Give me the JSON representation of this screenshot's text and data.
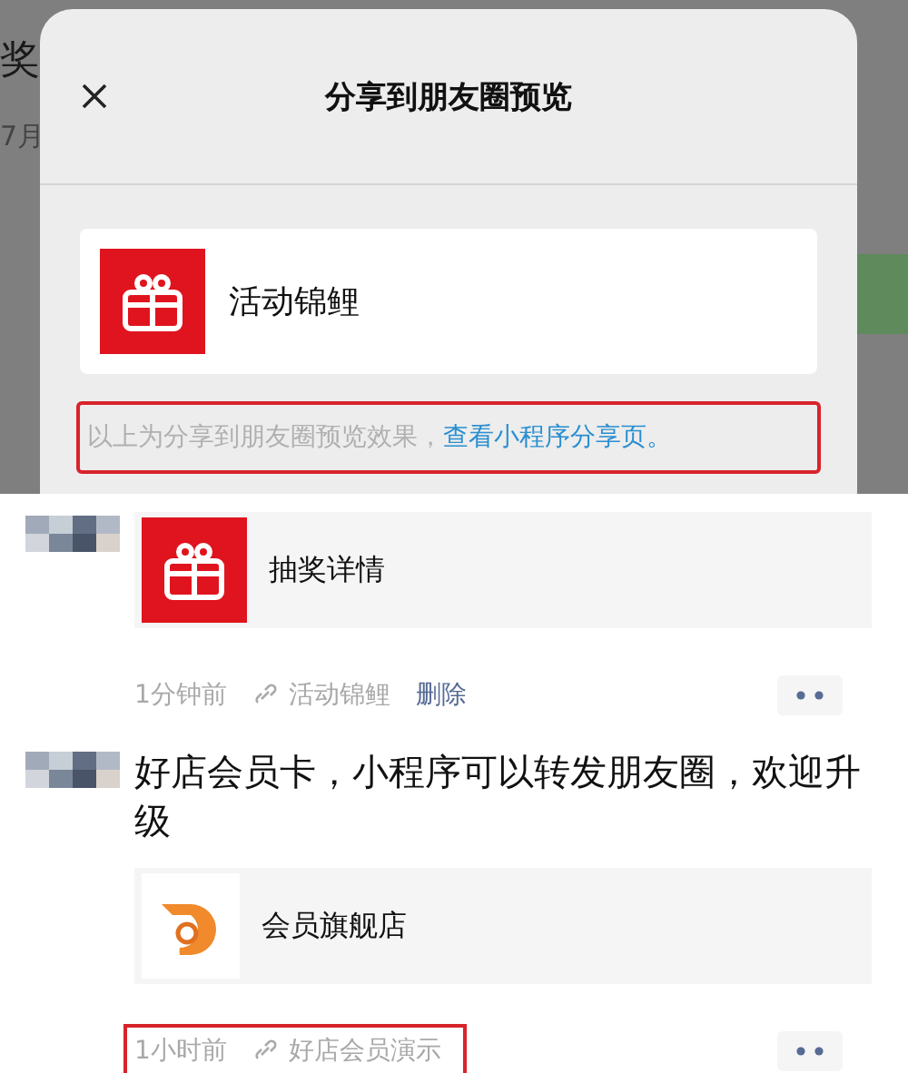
{
  "background": {
    "title_fragment": "奖",
    "date_fragment": "7月"
  },
  "dialog": {
    "title": "分享到朋友圈预览",
    "card": {
      "kind": "lottery",
      "title": "活动锦鲤"
    },
    "hint": {
      "text": "以上为分享到朋友圈预览效果，",
      "link": "查看小程序分享页。",
      "highlighted": true
    }
  },
  "posts": [
    {
      "card": {
        "kind": "lottery",
        "title": "抽奖详情"
      },
      "time": "1分钟前",
      "source": "活动锦鲤",
      "delete": "删除",
      "highlighted": false
    },
    {
      "text": "好店会员卡，小程序可以转发朋友圈，欢迎升级",
      "card": {
        "kind": "shop",
        "title": "会员旗舰店"
      },
      "time": "1小时前",
      "source": "好店会员演示",
      "highlighted": true
    }
  ]
}
